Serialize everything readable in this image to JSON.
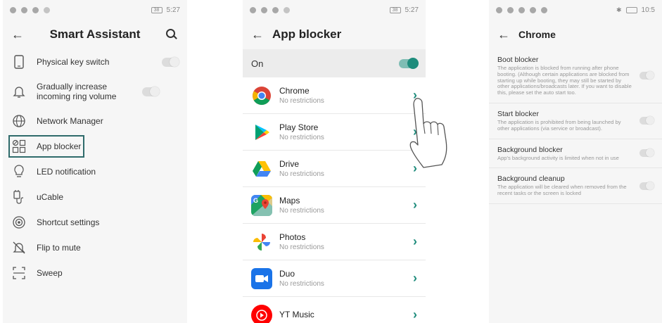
{
  "colors": {
    "accent": "#1e8c7c",
    "highlight": "#2f6b6b"
  },
  "phone1": {
    "status": {
      "time": "5:27",
      "battery": "38"
    },
    "title": "Smart Assistant",
    "items": [
      {
        "label": "Physical key switch",
        "icon": "phone-outline-icon",
        "toggle": false
      },
      {
        "label": "Gradually increase incoming ring volume",
        "icon": "bell-icon",
        "toggle": false
      },
      {
        "label": "Network Manager",
        "icon": "globe-icon"
      },
      {
        "label": "App blocker",
        "icon": "app-blocker-icon",
        "highlighted": true
      },
      {
        "label": "LED notification",
        "icon": "lightbulb-icon"
      },
      {
        "label": "uCable",
        "icon": "cable-icon"
      },
      {
        "label": "Shortcut settings",
        "icon": "target-icon"
      },
      {
        "label": "Flip to mute",
        "icon": "mute-bell-icon"
      },
      {
        "label": "Sweep",
        "icon": "scan-frame-icon"
      }
    ]
  },
  "phone2": {
    "status": {
      "time": "5:27",
      "battery": "38"
    },
    "title": "App blocker",
    "master": {
      "label": "On",
      "enabled": true
    },
    "apps": [
      {
        "name": "Chrome",
        "status": "No restrictions",
        "icon": "chrome-icon"
      },
      {
        "name": "Play Store",
        "status": "No restrictions",
        "icon": "play-store-icon"
      },
      {
        "name": "Drive",
        "status": "No restrictions",
        "icon": "drive-icon"
      },
      {
        "name": "Maps",
        "status": "No restrictions",
        "icon": "maps-icon"
      },
      {
        "name": "Photos",
        "status": "No restrictions",
        "icon": "photos-icon"
      },
      {
        "name": "Duo",
        "status": "No restrictions",
        "icon": "duo-icon"
      },
      {
        "name": "YT Music",
        "status": "",
        "icon": "yt-music-icon"
      }
    ]
  },
  "phone3": {
    "status": {
      "time": "10:5"
    },
    "title": "Chrome",
    "sections": [
      {
        "title": "Boot blocker",
        "desc": "The application is blocked from running after phone booting. (Although certain applications are blocked from starting up while booting, they may still be started by other applications/broadcasts later. If you want to disable this, please set the auto start too.",
        "enabled": false
      },
      {
        "title": "Start blocker",
        "desc": "The application is prohibited from being launched by other applications (via service or broadcast).",
        "enabled": false
      },
      {
        "title": "Background blocker",
        "desc": "App's background activity is limited when not in use",
        "enabled": false
      },
      {
        "title": "Background cleanup",
        "desc": "The application will be cleared when removed from the recent tasks or the screen is locked",
        "enabled": false
      }
    ]
  }
}
